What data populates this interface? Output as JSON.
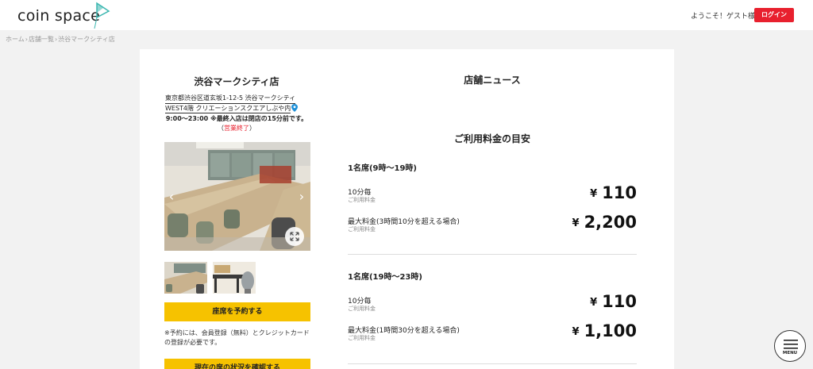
{
  "header": {
    "logo_text": "coin space",
    "welcome": "ようこそ！ゲスト様",
    "login_label": "ログイン"
  },
  "breadcrumb": [
    "ホーム",
    "店舗一覧",
    "渋谷マークシティ店"
  ],
  "store": {
    "name": "渋谷マークシティ店",
    "address_line1": "東京都渋谷区道玄坂1-12-5 渋谷マークシティ",
    "address_line2": "WEST4階 クリエーションスクエアしぶや内",
    "hours": "9:00～23:00 ※最終入店は閉店の15分前です。",
    "status_open_paren": "（",
    "status": "営業終了",
    "status_close_paren": "）",
    "reserve_label": "座席を予約する",
    "note": "※予約には、会員登録（無料）とクレジットカードの登録が必要です。",
    "seat_status_label": "現在の席の状況を確認する"
  },
  "news": {
    "title": "店舗ニュース"
  },
  "pricing": {
    "title": "ご利用料金の目安",
    "sections": [
      {
        "title": "1名席(9時～19時)",
        "rows": [
          {
            "label": "10分毎",
            "sub": "ご利用料金",
            "currency": "¥",
            "price": "110"
          },
          {
            "label": "最大料金(3時間10分を超える場合)",
            "sub": "ご利用料金",
            "currency": "¥",
            "price": "2,200"
          }
        ]
      },
      {
        "title": "1名席(19時～23時)",
        "rows": [
          {
            "label": "10分毎",
            "sub": "ご利用料金",
            "currency": "¥",
            "price": "110"
          },
          {
            "label": "最大料金(1時間30分を超える場合)",
            "sub": "ご利用料金",
            "currency": "¥",
            "price": "1,100"
          }
        ]
      }
    ]
  },
  "menu": {
    "label": "MENU"
  },
  "colors": {
    "accent_red": "#e8202e",
    "button_yellow": "#f6c200",
    "logo_teal": "#3bb7b0"
  }
}
